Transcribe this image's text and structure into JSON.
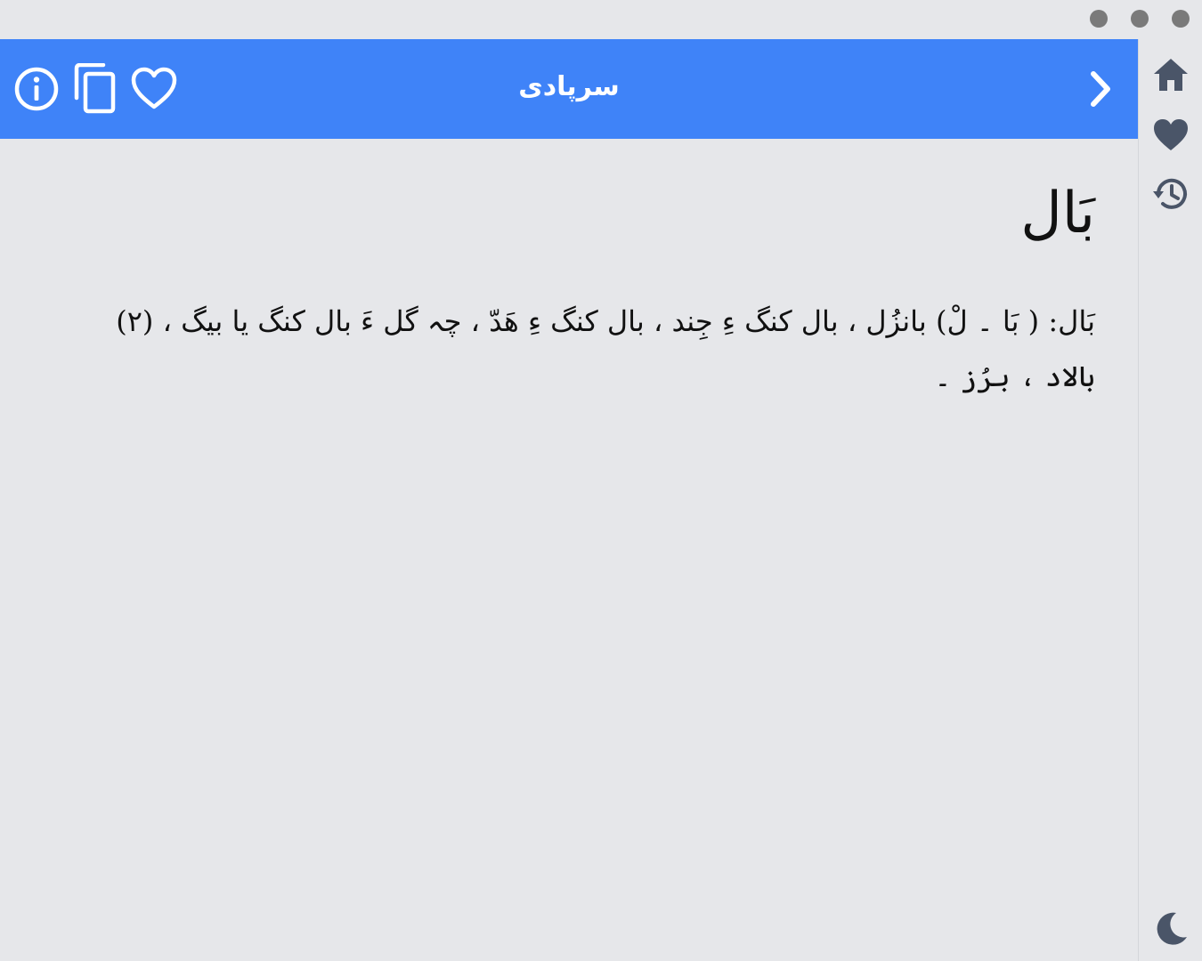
{
  "window": {
    "controls": [
      "dot",
      "dot",
      "dot"
    ]
  },
  "header": {
    "title": "سرپادی",
    "icons": {
      "back": "chevron-right-icon",
      "info": "info-icon",
      "copy": "copy-icon",
      "favorite": "heart-outline-icon"
    }
  },
  "sidebar": {
    "items": [
      {
        "icon": "home-icon"
      },
      {
        "icon": "heart-icon"
      },
      {
        "icon": "history-icon"
      }
    ],
    "theme_toggle": "moon-icon"
  },
  "entry": {
    "headword": "بَال",
    "definition": "بَال: ( بَا ۔ لْ) بانزُل ، بال کنگ ءِ جِند ، بال کنگ ءِ ھَدّ ، چہ گل ءَ بال کنگ یا بیگ ، (۲) بالاد ، برُز ۔"
  },
  "colors": {
    "header": "#3f83f8",
    "background": "#e6e7ea",
    "sidebar_icon": "#4a5568",
    "dot": "#7a7a7a"
  }
}
